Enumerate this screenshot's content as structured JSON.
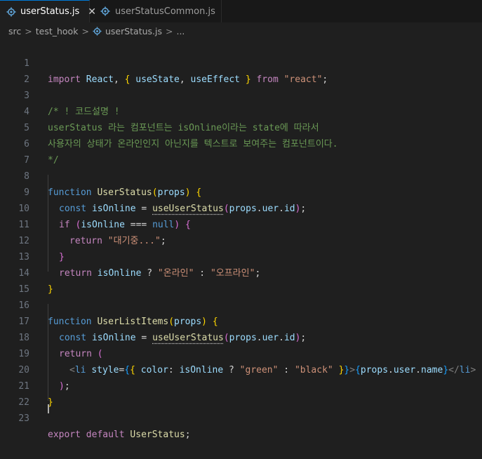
{
  "tabs": [
    {
      "label": "userStatus.js",
      "icon": "gear-icon",
      "active": true,
      "close": "✕"
    },
    {
      "label": "userStatusCommon.js",
      "icon": "gear-icon",
      "active": false
    }
  ],
  "breadcrumb": {
    "items": [
      "src",
      "test_hook",
      "userStatus.js",
      "..."
    ],
    "separator": ">"
  },
  "line_numbers": [
    "1",
    "2",
    "3",
    "4",
    "5",
    "6",
    "7",
    "8",
    "9",
    "10",
    "11",
    "12",
    "13",
    "14",
    "15",
    "16",
    "17",
    "18",
    "19",
    "20",
    "21",
    "22",
    "23"
  ],
  "code": {
    "l1": {
      "kw_import": "import",
      "react": "React",
      "comma": ", ",
      "brace_open": "{",
      "use_state": "useState",
      "comma2": ", ",
      "use_effect": "useEffect",
      "brace_close": "}",
      "kw_from": "from",
      "module": "\"react\"",
      "semi": ";"
    },
    "l3": "/* ! 코드설명 !",
    "l4": "userStatus 라는 컴포넌트는 isOnline이라는 state에 따라서",
    "l5": "사용자의 상태가 온라인인지 아닌지를 텍스트로 보여주는 컴포넌트이다.",
    "l6": "*/",
    "l8": {
      "kw": "function",
      "name": "UserStatus",
      "p_open": "(",
      "param": "props",
      "p_close": ")",
      "brace": "{"
    },
    "l9": {
      "kw": "const",
      "var": "isOnline",
      "eq": " = ",
      "call": "useUserStatus",
      "p_open": "(",
      "a1": "props",
      "d1": ".",
      "a2": "uer",
      "d2": ".",
      "a3": "id",
      "p_close": ")",
      "semi": ";"
    },
    "l10": {
      "kw": "if",
      "p_open": "(",
      "var": "isOnline",
      "op": " === ",
      "val": "null",
      "p_close": ")",
      "brace": "{"
    },
    "l11": {
      "kw": "return",
      "str": "\"대기중...\"",
      "semi": ";"
    },
    "l12": "}",
    "l13": {
      "kw": "return",
      "var": "isOnline",
      "q": " ? ",
      "s1": "\"온라인\"",
      "c": " : ",
      "s2": "\"오프라인\"",
      "semi": ";"
    },
    "l14": "}",
    "l16": {
      "kw": "function",
      "name": "UserListItems",
      "p_open": "(",
      "param": "props",
      "p_close": ")",
      "brace": "{"
    },
    "l17": {
      "kw": "const",
      "var": "isOnline",
      "eq": " = ",
      "call": "useUserStatus",
      "p_open": "(",
      "a1": "props",
      "d1": ".",
      "a2": "uer",
      "d2": ".",
      "a3": "id",
      "p_close": ")",
      "semi": ";"
    },
    "l18": {
      "kw": "return",
      "paren": "("
    },
    "l19": {
      "lt": "<",
      "tag": "li",
      "attr": "style",
      "eqs": "=",
      "b_open": "{",
      "b2_open": "{",
      "key": "color",
      "colon": ": ",
      "var": "isOnline",
      "q": " ? ",
      "s1": "\"green\"",
      "c": " : ",
      "s2": "\"black\"",
      "b2_close": "}",
      "b_close": "}",
      "gt": ">",
      "e_open": "{",
      "x1": "props",
      "d1": ".",
      "x2": "user",
      "d2": ".",
      "x3": "name",
      "e_close": "}",
      "end": "</",
      "etag": "li",
      "egt": ">"
    },
    "l20": {
      "paren": ")",
      "semi": ";"
    },
    "l21": "}",
    "l23": {
      "kw": "export",
      "kw2": "default",
      "name": "UserStatus",
      "semi": ";"
    }
  },
  "colors": {
    "keyword": "#c586c0",
    "storage": "#569cd6",
    "function": "#dcdcaa",
    "variable": "#9cdcfe",
    "string": "#ce9178",
    "comment": "#6a9955",
    "accent": "#0078d4"
  }
}
